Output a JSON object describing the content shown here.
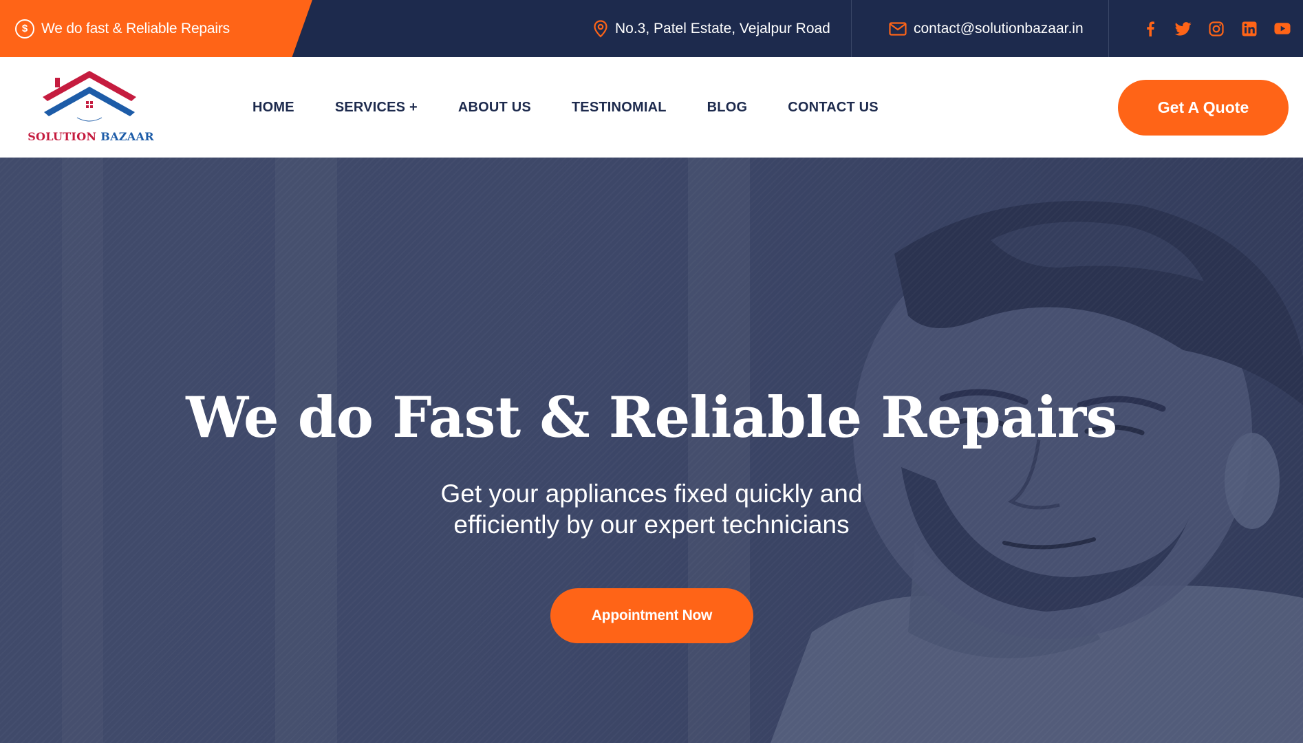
{
  "topbar": {
    "promo_icon": "dollar-circle-icon",
    "promo_text": "We do fast & Reliable Repairs",
    "address": "No.3, Patel Estate, Vejalpur Road",
    "email": "contact@solutionbazaar.in",
    "social_icons": [
      "facebook-icon",
      "twitter-icon",
      "instagram-icon",
      "linkedin-icon",
      "youtube-icon"
    ]
  },
  "logo": {
    "word1": "SOLUTION",
    "word2": "BAZAAR"
  },
  "nav": {
    "items": [
      "HOME",
      "SERVICES +",
      "ABOUT US",
      "TESTINOMIAL",
      "BLOG",
      "CONTACT US"
    ]
  },
  "header": {
    "quote_label": "Get A Quote"
  },
  "hero": {
    "title": "We do Fast & Reliable Repairs",
    "subtitle_line1": "Get your appliances fixed quickly and",
    "subtitle_line2": "efficiently by our expert technicians",
    "cta_label": "Appointment Now"
  },
  "colors": {
    "accent": "#ff6417",
    "navy": "#1d2a4d",
    "hero_overlay": "#3d4768",
    "logo_red": "#c51c3f",
    "logo_blue": "#1d5ca8"
  }
}
